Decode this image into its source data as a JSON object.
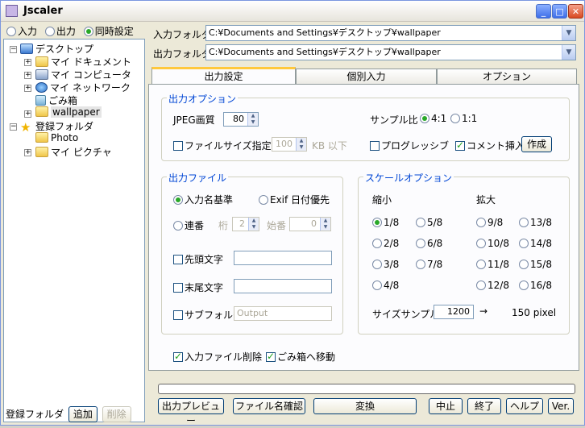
{
  "window": {
    "title": "Jscaler"
  },
  "left": {
    "mode_options": [
      {
        "label": "入力",
        "selected": false
      },
      {
        "label": "出力",
        "selected": false
      },
      {
        "label": "同時設定",
        "selected": true
      }
    ],
    "tree": [
      {
        "label": "デスクトップ",
        "icon": "desktop-icon"
      },
      {
        "label": "マイ ドキュメント",
        "icon": "folder-icon"
      },
      {
        "label": "マイ コンピュータ",
        "icon": "computer-icon"
      },
      {
        "label": "マイ ネットワーク",
        "icon": "network-icon"
      },
      {
        "label": "ごみ箱",
        "icon": "recycle-bin-icon"
      },
      {
        "label": "wallpaper",
        "icon": "folder-icon"
      },
      {
        "label": "登録フォルダ",
        "icon": "star-icon"
      },
      {
        "label": "Photo",
        "icon": "folder-icon"
      },
      {
        "label": "マイ ピクチャ",
        "icon": "pictures-icon"
      }
    ],
    "bottom_label": "登録フォルダ",
    "add_button": "追加",
    "delete_button": "削除"
  },
  "paths": {
    "input_label": "入力フォルダ",
    "input_value": "C:¥Documents and Settings¥デスクトップ¥wallpaper",
    "output_label": "出力フォルダ",
    "output_value": "C:¥Documents and Settings¥デスクトップ¥wallpaper"
  },
  "tabs": [
    "出力設定",
    "個別入力",
    "オプション"
  ],
  "output_options": {
    "title": "出力オプション",
    "jpeg_label": "JPEG画質",
    "jpeg_value": "80",
    "sample_label": "サンプル比",
    "sample_41": "4:1",
    "sample_11": "1:1",
    "filesize_label": "ファイルサイズ指定",
    "filesize_value": "100",
    "filesize_unit": "KB 以下",
    "progressive_label": "プログレッシブ",
    "comment_label": "コメント挿入",
    "create_button": "作成"
  },
  "output_file": {
    "title": "出力ファイル",
    "name_basis": "入力名基準",
    "exif_priority": "Exif 日付優先",
    "sequence": "連番",
    "digits_label": "桁",
    "digits_value": "2",
    "start_label": "始番",
    "start_value": "0",
    "prefix_label": "先頭文字",
    "suffix_label": "末尾文字",
    "subfolder_label": "サブフォルダ",
    "subfolder_placeholder": "Output"
  },
  "scale": {
    "title": "スケールオプション",
    "reduce_label": "縮小",
    "enlarge_label": "拡大",
    "reduce": [
      "1/8",
      "5/8",
      "2/8",
      "6/8",
      "3/8",
      "7/8",
      "4/8"
    ],
    "enlarge": [
      "9/8",
      "13/8",
      "10/8",
      "14/8",
      "11/8",
      "15/8",
      "12/8",
      "16/8"
    ],
    "size_sample_label": "サイズサンプル",
    "size_sample_value": "1200",
    "arrow": "→",
    "size_result": "150 pixel"
  },
  "after": {
    "delete_input": "入力ファイル削除",
    "move_trash": "ごみ箱へ移動"
  },
  "buttons": {
    "preview": "出力プレビュー",
    "check_names": "ファイル名確認",
    "convert": "変換",
    "stop": "中止",
    "exit": "終了",
    "help": "ヘルプ",
    "version": "Ver."
  }
}
